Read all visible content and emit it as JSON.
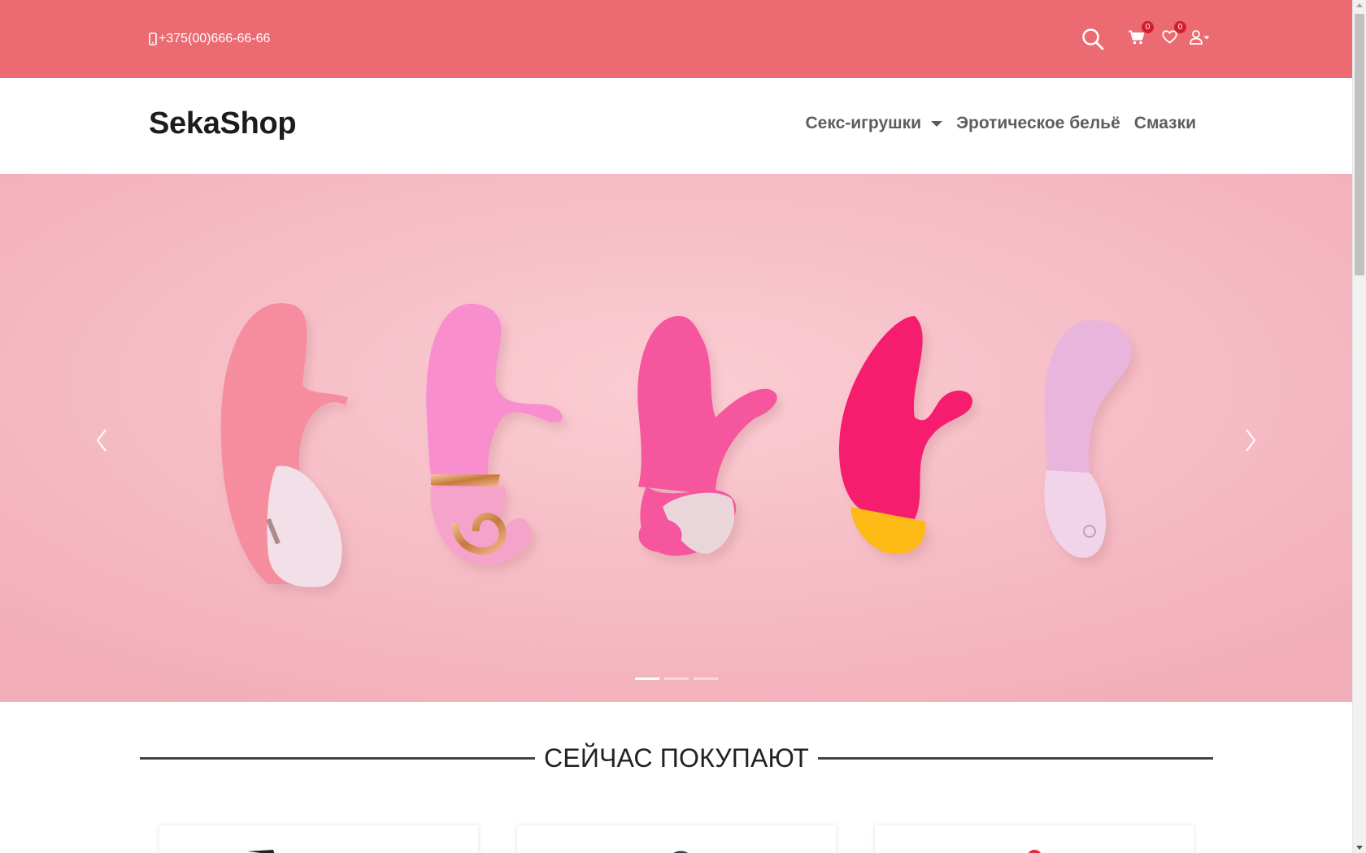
{
  "topbar": {
    "phone": "+375(00)666-66-66",
    "phone_icon": "mobile-phone-icon",
    "search_icon": "search-icon",
    "cart_icon": "cart-icon",
    "cart_count": "0",
    "wishlist_icon": "heart-icon",
    "wishlist_count": "0",
    "user_icon": "user-icon"
  },
  "header": {
    "logo": "SekaShop",
    "nav": [
      {
        "label": "Секс-игрушки",
        "has_dropdown": true
      },
      {
        "label": "Эротическое бельё"
      },
      {
        "label": "Смазки"
      }
    ]
  },
  "hero": {
    "slide_count": 3,
    "active_slide": 1,
    "prev_icon": "chevron-left-icon",
    "next_icon": "chevron-right-icon"
  },
  "section": {
    "title": "СЕЙЧАС ПОКУПАЮТ"
  },
  "colors": {
    "topbar": "#ec6a72",
    "hero_bg": "#f7bcc6",
    "badge": "#d41c2c",
    "nav_text": "#5d5d5d"
  }
}
